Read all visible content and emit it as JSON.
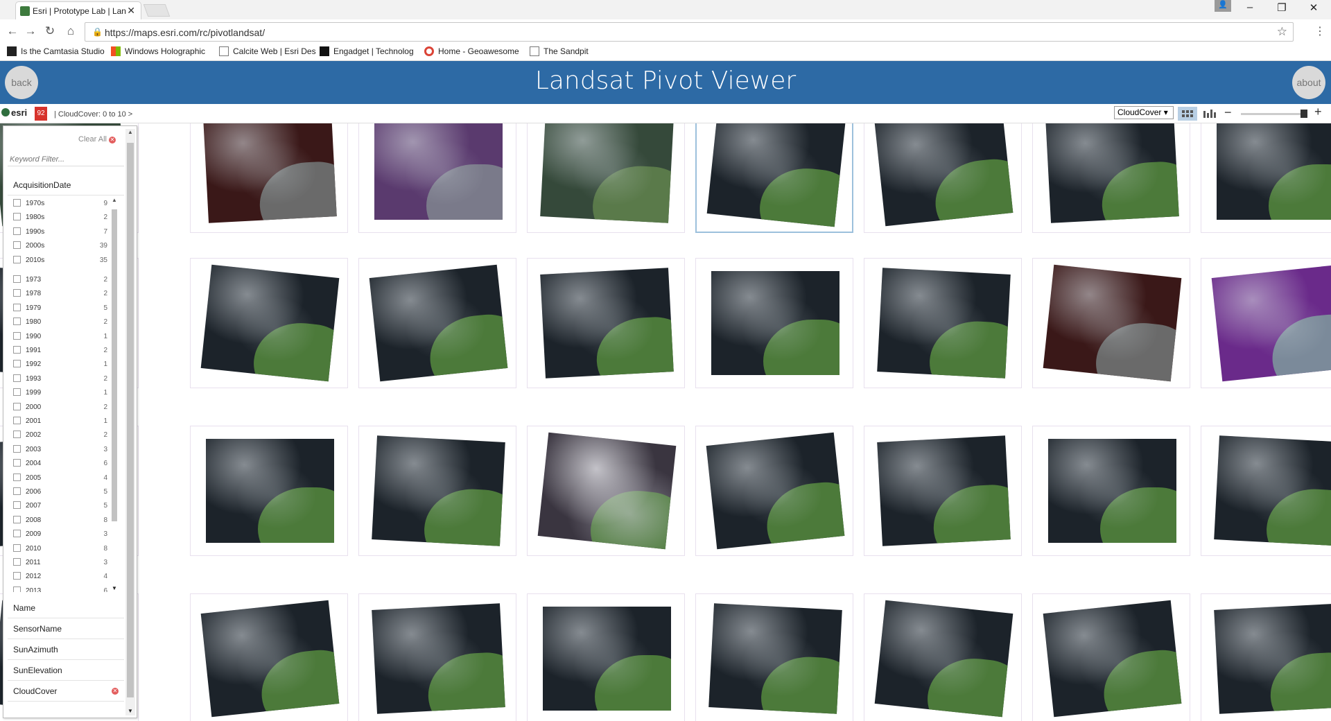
{
  "browser": {
    "tab_title": "Esri | Prototype Lab | Lan",
    "url": "https://maps.esri.com/rc/pivotlandsat/",
    "bookmarks": [
      {
        "label": "Is the Camtasia Studio",
        "icon": "camtasia-icon"
      },
      {
        "label": "Windows Holographic",
        "icon": "windows-icon"
      },
      {
        "label": "Calcite Web | Esri Des",
        "icon": "page-icon"
      },
      {
        "label": "Engadget | Technolog",
        "icon": "engadget-icon"
      },
      {
        "label": "Home - Geoawesome",
        "icon": "google-icon"
      },
      {
        "label": "The Sandpit",
        "icon": "page-icon"
      }
    ]
  },
  "app": {
    "title": "Landsat Pivot Viewer",
    "back_label": "back",
    "about_label": "about"
  },
  "pivotbar": {
    "logo": "esri",
    "count": "92",
    "breadcrumb": "| CloudCover: 0 to 10 >",
    "sort_by": "CloudCover ▾"
  },
  "filter": {
    "clear_all": "Clear All",
    "keyword_placeholder": "Keyword Filter...",
    "categories": {
      "acquisition": "AcquisitionDate",
      "name": "Name",
      "sensor": "SensorName",
      "azimuth": "SunAzimuth",
      "elevation": "SunElevation",
      "cloud": "CloudCover"
    },
    "decades": [
      {
        "label": "1970s",
        "count": "9"
      },
      {
        "label": "1980s",
        "count": "2"
      },
      {
        "label": "1990s",
        "count": "7"
      },
      {
        "label": "2000s",
        "count": "39"
      },
      {
        "label": "2010s",
        "count": "35"
      }
    ],
    "years": [
      {
        "label": "1973",
        "count": "2"
      },
      {
        "label": "1978",
        "count": "2"
      },
      {
        "label": "1979",
        "count": "5"
      },
      {
        "label": "1980",
        "count": "2"
      },
      {
        "label": "1990",
        "count": "1"
      },
      {
        "label": "1991",
        "count": "2"
      },
      {
        "label": "1992",
        "count": "1"
      },
      {
        "label": "1993",
        "count": "2"
      },
      {
        "label": "1999",
        "count": "1"
      },
      {
        "label": "2000",
        "count": "2"
      },
      {
        "label": "2001",
        "count": "1"
      },
      {
        "label": "2002",
        "count": "2"
      },
      {
        "label": "2003",
        "count": "3"
      },
      {
        "label": "2004",
        "count": "6"
      },
      {
        "label": "2005",
        "count": "4"
      },
      {
        "label": "2006",
        "count": "5"
      },
      {
        "label": "2007",
        "count": "5"
      },
      {
        "label": "2008",
        "count": "8"
      },
      {
        "label": "2009",
        "count": "3"
      },
      {
        "label": "2010",
        "count": "8"
      },
      {
        "label": "2011",
        "count": "3"
      },
      {
        "label": "2012",
        "count": "4"
      },
      {
        "label": "2013",
        "count": "6"
      }
    ]
  },
  "grid": {
    "tiles": [
      [
        "green",
        "brown",
        "purple",
        "green",
        "dark-selected",
        "dark",
        "dark",
        "dark"
      ],
      [
        "dark",
        "dark",
        "dark",
        "dark",
        "dark",
        "dark",
        "brown",
        "violet"
      ],
      [
        "dark",
        "dark",
        "dark",
        "cloudy",
        "dark",
        "dark",
        "dark",
        "dark"
      ],
      [
        "dark",
        "dark",
        "dark",
        "dark",
        "dark",
        "dark",
        "dark",
        "dark"
      ]
    ]
  }
}
